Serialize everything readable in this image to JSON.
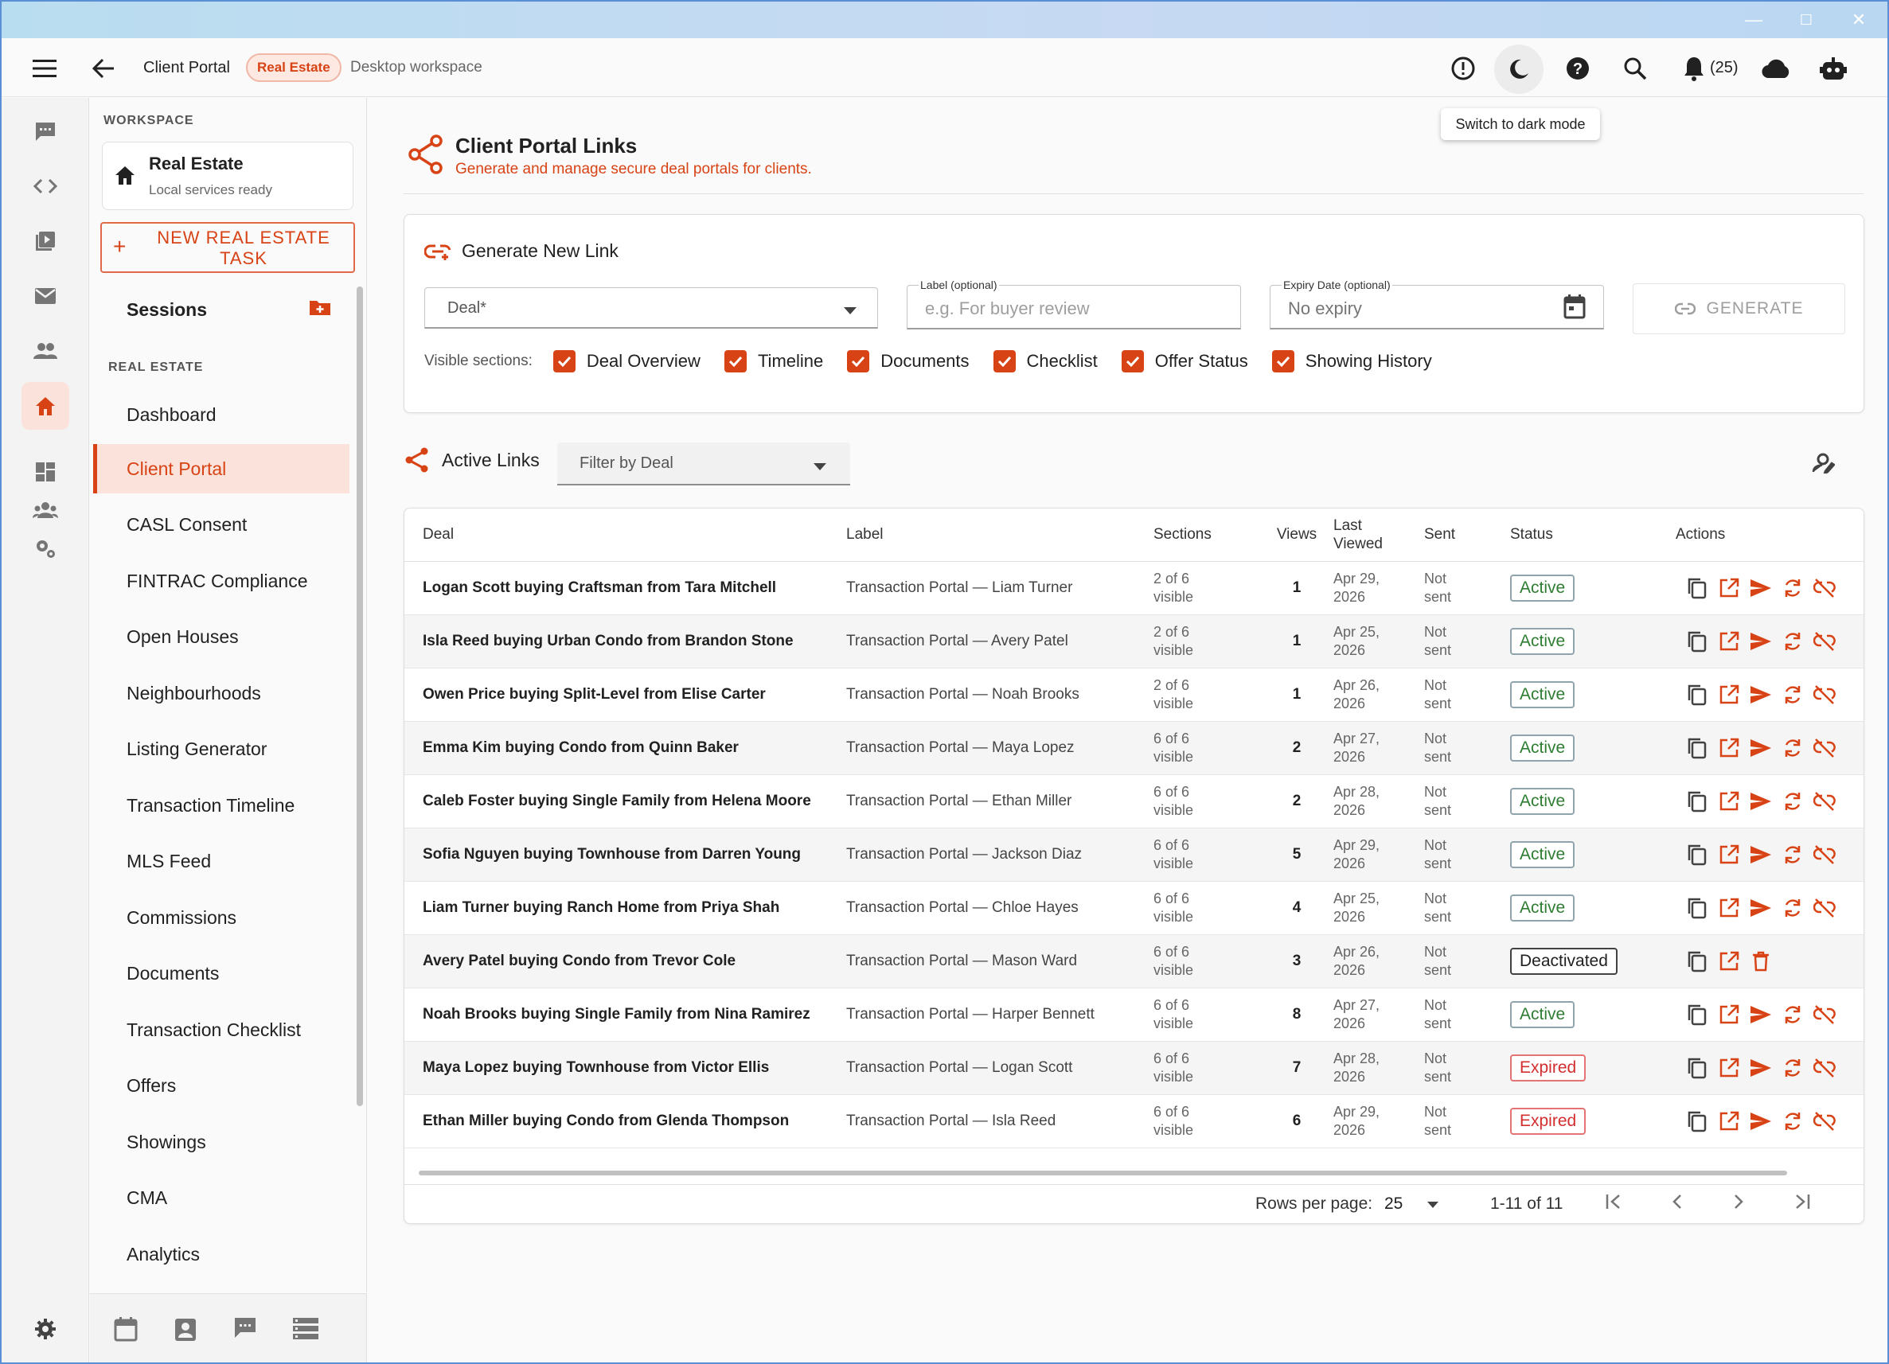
{
  "app": {
    "breadcrumb_title": "Client Portal",
    "workspace_chip": "Real Estate",
    "workspace_mode": "Desktop workspace",
    "notif_count": "(25)",
    "tooltip": "Switch to dark mode"
  },
  "workspace": {
    "section_label": "WORKSPACE",
    "name": "Real Estate",
    "status": "Local services ready",
    "new_task_label": "NEW REAL ESTATE TASK"
  },
  "sidebar": {
    "sessions_label": "Sessions",
    "section_label": "REAL ESTATE",
    "items": [
      {
        "label": "Dashboard"
      },
      {
        "label": "Client Portal"
      },
      {
        "label": "CASL Consent"
      },
      {
        "label": "FINTRAC Compliance"
      },
      {
        "label": "Open Houses"
      },
      {
        "label": "Neighbourhoods"
      },
      {
        "label": "Listing Generator"
      },
      {
        "label": "Transaction Timeline"
      },
      {
        "label": "MLS Feed"
      },
      {
        "label": "Commissions"
      },
      {
        "label": "Documents"
      },
      {
        "label": "Transaction Checklist"
      },
      {
        "label": "Offers"
      },
      {
        "label": "Showings"
      },
      {
        "label": "CMA"
      },
      {
        "label": "Analytics"
      }
    ]
  },
  "page": {
    "title": "Client Portal Links",
    "subtitle": "Generate and manage secure deal portals for clients."
  },
  "generate": {
    "title": "Generate New Link",
    "deal_placeholder": "Deal*",
    "label_label": "Label (optional)",
    "label_placeholder": "e.g. For buyer review",
    "expiry_label": "Expiry Date (optional)",
    "expiry_value": "No expiry",
    "button": "GENERATE",
    "visible_sections_label": "Visible sections:",
    "sections": [
      "Deal Overview",
      "Timeline",
      "Documents",
      "Checklist",
      "Offer Status",
      "Showing History"
    ]
  },
  "links": {
    "title": "Active Links",
    "filter_placeholder": "Filter by Deal",
    "columns": {
      "deal": "Deal",
      "label": "Label",
      "sections": "Sections",
      "views": "Views",
      "last_viewed_1": "Last",
      "last_viewed_2": "Viewed",
      "sent": "Sent",
      "status": "Status",
      "actions": "Actions"
    },
    "rows": [
      {
        "deal": "Logan Scott buying Craftsman from Tara Mitchell",
        "label": "Transaction Portal — Liam Turner",
        "sections_1": "2 of 6",
        "sections_2": "visible",
        "views": "1",
        "lv_1": "Apr 29,",
        "lv_2": "2026",
        "sent_1": "Not",
        "sent_2": "sent",
        "status": "Active",
        "status_kind": "active"
      },
      {
        "deal": "Isla Reed buying Urban Condo from Brandon Stone",
        "label": "Transaction Portal — Avery Patel",
        "sections_1": "2 of 6",
        "sections_2": "visible",
        "views": "1",
        "lv_1": "Apr 25,",
        "lv_2": "2026",
        "sent_1": "Not",
        "sent_2": "sent",
        "status": "Active",
        "status_kind": "active"
      },
      {
        "deal": "Owen Price buying Split-Level from Elise Carter",
        "label": "Transaction Portal — Noah Brooks",
        "sections_1": "2 of 6",
        "sections_2": "visible",
        "views": "1",
        "lv_1": "Apr 26,",
        "lv_2": "2026",
        "sent_1": "Not",
        "sent_2": "sent",
        "status": "Active",
        "status_kind": "active"
      },
      {
        "deal": "Emma Kim buying Condo from Quinn Baker",
        "label": "Transaction Portal — Maya Lopez",
        "sections_1": "6 of 6",
        "sections_2": "visible",
        "views": "2",
        "lv_1": "Apr 27,",
        "lv_2": "2026",
        "sent_1": "Not",
        "sent_2": "sent",
        "status": "Active",
        "status_kind": "active"
      },
      {
        "deal": "Caleb Foster buying Single Family from Helena Moore",
        "label": "Transaction Portal — Ethan Miller",
        "sections_1": "6 of 6",
        "sections_2": "visible",
        "views": "2",
        "lv_1": "Apr 28,",
        "lv_2": "2026",
        "sent_1": "Not",
        "sent_2": "sent",
        "status": "Active",
        "status_kind": "active"
      },
      {
        "deal": "Sofia Nguyen buying Townhouse from Darren Young",
        "label": "Transaction Portal — Jackson Diaz",
        "sections_1": "6 of 6",
        "sections_2": "visible",
        "views": "5",
        "lv_1": "Apr 29,",
        "lv_2": "2026",
        "sent_1": "Not",
        "sent_2": "sent",
        "status": "Active",
        "status_kind": "active"
      },
      {
        "deal": "Liam Turner buying Ranch Home from Priya Shah",
        "label": "Transaction Portal — Chloe Hayes",
        "sections_1": "6 of 6",
        "sections_2": "visible",
        "views": "4",
        "lv_1": "Apr 25,",
        "lv_2": "2026",
        "sent_1": "Not",
        "sent_2": "sent",
        "status": "Active",
        "status_kind": "active"
      },
      {
        "deal": "Avery Patel buying Condo from Trevor Cole",
        "label": "Transaction Portal — Mason Ward",
        "sections_1": "6 of 6",
        "sections_2": "visible",
        "views": "3",
        "lv_1": "Apr 26,",
        "lv_2": "2026",
        "sent_1": "Not",
        "sent_2": "sent",
        "status": "Deactivated",
        "status_kind": "deact"
      },
      {
        "deal": "Noah Brooks buying Single Family from Nina Ramirez",
        "label": "Transaction Portal — Harper Bennett",
        "sections_1": "6 of 6",
        "sections_2": "visible",
        "views": "8",
        "lv_1": "Apr 27,",
        "lv_2": "2026",
        "sent_1": "Not",
        "sent_2": "sent",
        "status": "Active",
        "status_kind": "active"
      },
      {
        "deal": "Maya Lopez buying Townhouse from Victor Ellis",
        "label": "Transaction Portal — Logan Scott",
        "sections_1": "6 of 6",
        "sections_2": "visible",
        "views": "7",
        "lv_1": "Apr 28,",
        "lv_2": "2026",
        "sent_1": "Not",
        "sent_2": "sent",
        "status": "Expired",
        "status_kind": "exp"
      },
      {
        "deal": "Ethan Miller buying Condo from Glenda Thompson",
        "label": "Transaction Portal — Isla Reed",
        "sections_1": "6 of 6",
        "sections_2": "visible",
        "views": "6",
        "lv_1": "Apr 29,",
        "lv_2": "2026",
        "sent_1": "Not",
        "sent_2": "sent",
        "status": "Expired",
        "status_kind": "exp"
      }
    ],
    "pagination": {
      "rows_per_page_label": "Rows per page:",
      "rows_per_page": "25",
      "range": "1-11 of 11"
    }
  },
  "colors": {
    "accent": "#d84315",
    "accent_light": "#fbe3dc",
    "active_text": "#2e7d32",
    "expired": "#d32f2f"
  }
}
